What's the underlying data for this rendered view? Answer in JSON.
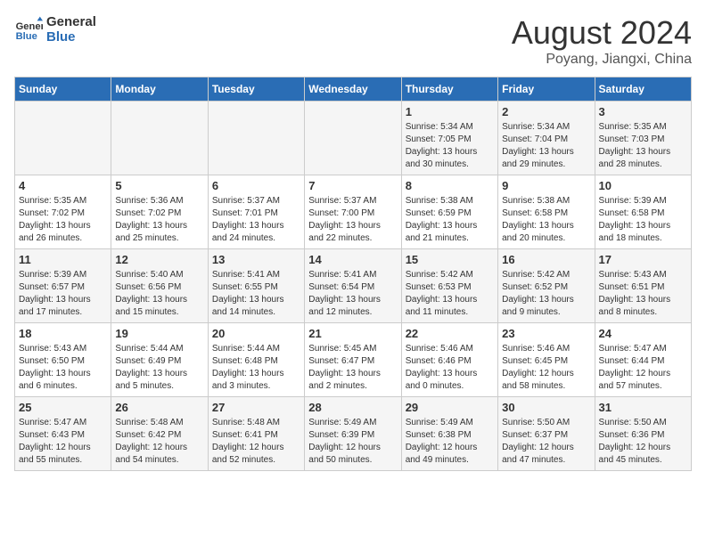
{
  "header": {
    "logo_line1": "General",
    "logo_line2": "Blue",
    "title": "August 2024",
    "subtitle": "Poyang, Jiangxi, China"
  },
  "days_of_week": [
    "Sunday",
    "Monday",
    "Tuesday",
    "Wednesday",
    "Thursday",
    "Friday",
    "Saturday"
  ],
  "weeks": [
    [
      {
        "day": "",
        "info": ""
      },
      {
        "day": "",
        "info": ""
      },
      {
        "day": "",
        "info": ""
      },
      {
        "day": "",
        "info": ""
      },
      {
        "day": "1",
        "info": "Sunrise: 5:34 AM\nSunset: 7:05 PM\nDaylight: 13 hours and 30 minutes."
      },
      {
        "day": "2",
        "info": "Sunrise: 5:34 AM\nSunset: 7:04 PM\nDaylight: 13 hours and 29 minutes."
      },
      {
        "day": "3",
        "info": "Sunrise: 5:35 AM\nSunset: 7:03 PM\nDaylight: 13 hours and 28 minutes."
      }
    ],
    [
      {
        "day": "4",
        "info": "Sunrise: 5:35 AM\nSunset: 7:02 PM\nDaylight: 13 hours and 26 minutes."
      },
      {
        "day": "5",
        "info": "Sunrise: 5:36 AM\nSunset: 7:02 PM\nDaylight: 13 hours and 25 minutes."
      },
      {
        "day": "6",
        "info": "Sunrise: 5:37 AM\nSunset: 7:01 PM\nDaylight: 13 hours and 24 minutes."
      },
      {
        "day": "7",
        "info": "Sunrise: 5:37 AM\nSunset: 7:00 PM\nDaylight: 13 hours and 22 minutes."
      },
      {
        "day": "8",
        "info": "Sunrise: 5:38 AM\nSunset: 6:59 PM\nDaylight: 13 hours and 21 minutes."
      },
      {
        "day": "9",
        "info": "Sunrise: 5:38 AM\nSunset: 6:58 PM\nDaylight: 13 hours and 20 minutes."
      },
      {
        "day": "10",
        "info": "Sunrise: 5:39 AM\nSunset: 6:58 PM\nDaylight: 13 hours and 18 minutes."
      }
    ],
    [
      {
        "day": "11",
        "info": "Sunrise: 5:39 AM\nSunset: 6:57 PM\nDaylight: 13 hours and 17 minutes."
      },
      {
        "day": "12",
        "info": "Sunrise: 5:40 AM\nSunset: 6:56 PM\nDaylight: 13 hours and 15 minutes."
      },
      {
        "day": "13",
        "info": "Sunrise: 5:41 AM\nSunset: 6:55 PM\nDaylight: 13 hours and 14 minutes."
      },
      {
        "day": "14",
        "info": "Sunrise: 5:41 AM\nSunset: 6:54 PM\nDaylight: 13 hours and 12 minutes."
      },
      {
        "day": "15",
        "info": "Sunrise: 5:42 AM\nSunset: 6:53 PM\nDaylight: 13 hours and 11 minutes."
      },
      {
        "day": "16",
        "info": "Sunrise: 5:42 AM\nSunset: 6:52 PM\nDaylight: 13 hours and 9 minutes."
      },
      {
        "day": "17",
        "info": "Sunrise: 5:43 AM\nSunset: 6:51 PM\nDaylight: 13 hours and 8 minutes."
      }
    ],
    [
      {
        "day": "18",
        "info": "Sunrise: 5:43 AM\nSunset: 6:50 PM\nDaylight: 13 hours and 6 minutes."
      },
      {
        "day": "19",
        "info": "Sunrise: 5:44 AM\nSunset: 6:49 PM\nDaylight: 13 hours and 5 minutes."
      },
      {
        "day": "20",
        "info": "Sunrise: 5:44 AM\nSunset: 6:48 PM\nDaylight: 13 hours and 3 minutes."
      },
      {
        "day": "21",
        "info": "Sunrise: 5:45 AM\nSunset: 6:47 PM\nDaylight: 13 hours and 2 minutes."
      },
      {
        "day": "22",
        "info": "Sunrise: 5:46 AM\nSunset: 6:46 PM\nDaylight: 13 hours and 0 minutes."
      },
      {
        "day": "23",
        "info": "Sunrise: 5:46 AM\nSunset: 6:45 PM\nDaylight: 12 hours and 58 minutes."
      },
      {
        "day": "24",
        "info": "Sunrise: 5:47 AM\nSunset: 6:44 PM\nDaylight: 12 hours and 57 minutes."
      }
    ],
    [
      {
        "day": "25",
        "info": "Sunrise: 5:47 AM\nSunset: 6:43 PM\nDaylight: 12 hours and 55 minutes."
      },
      {
        "day": "26",
        "info": "Sunrise: 5:48 AM\nSunset: 6:42 PM\nDaylight: 12 hours and 54 minutes."
      },
      {
        "day": "27",
        "info": "Sunrise: 5:48 AM\nSunset: 6:41 PM\nDaylight: 12 hours and 52 minutes."
      },
      {
        "day": "28",
        "info": "Sunrise: 5:49 AM\nSunset: 6:39 PM\nDaylight: 12 hours and 50 minutes."
      },
      {
        "day": "29",
        "info": "Sunrise: 5:49 AM\nSunset: 6:38 PM\nDaylight: 12 hours and 49 minutes."
      },
      {
        "day": "30",
        "info": "Sunrise: 5:50 AM\nSunset: 6:37 PM\nDaylight: 12 hours and 47 minutes."
      },
      {
        "day": "31",
        "info": "Sunrise: 5:50 AM\nSunset: 6:36 PM\nDaylight: 12 hours and 45 minutes."
      }
    ]
  ]
}
